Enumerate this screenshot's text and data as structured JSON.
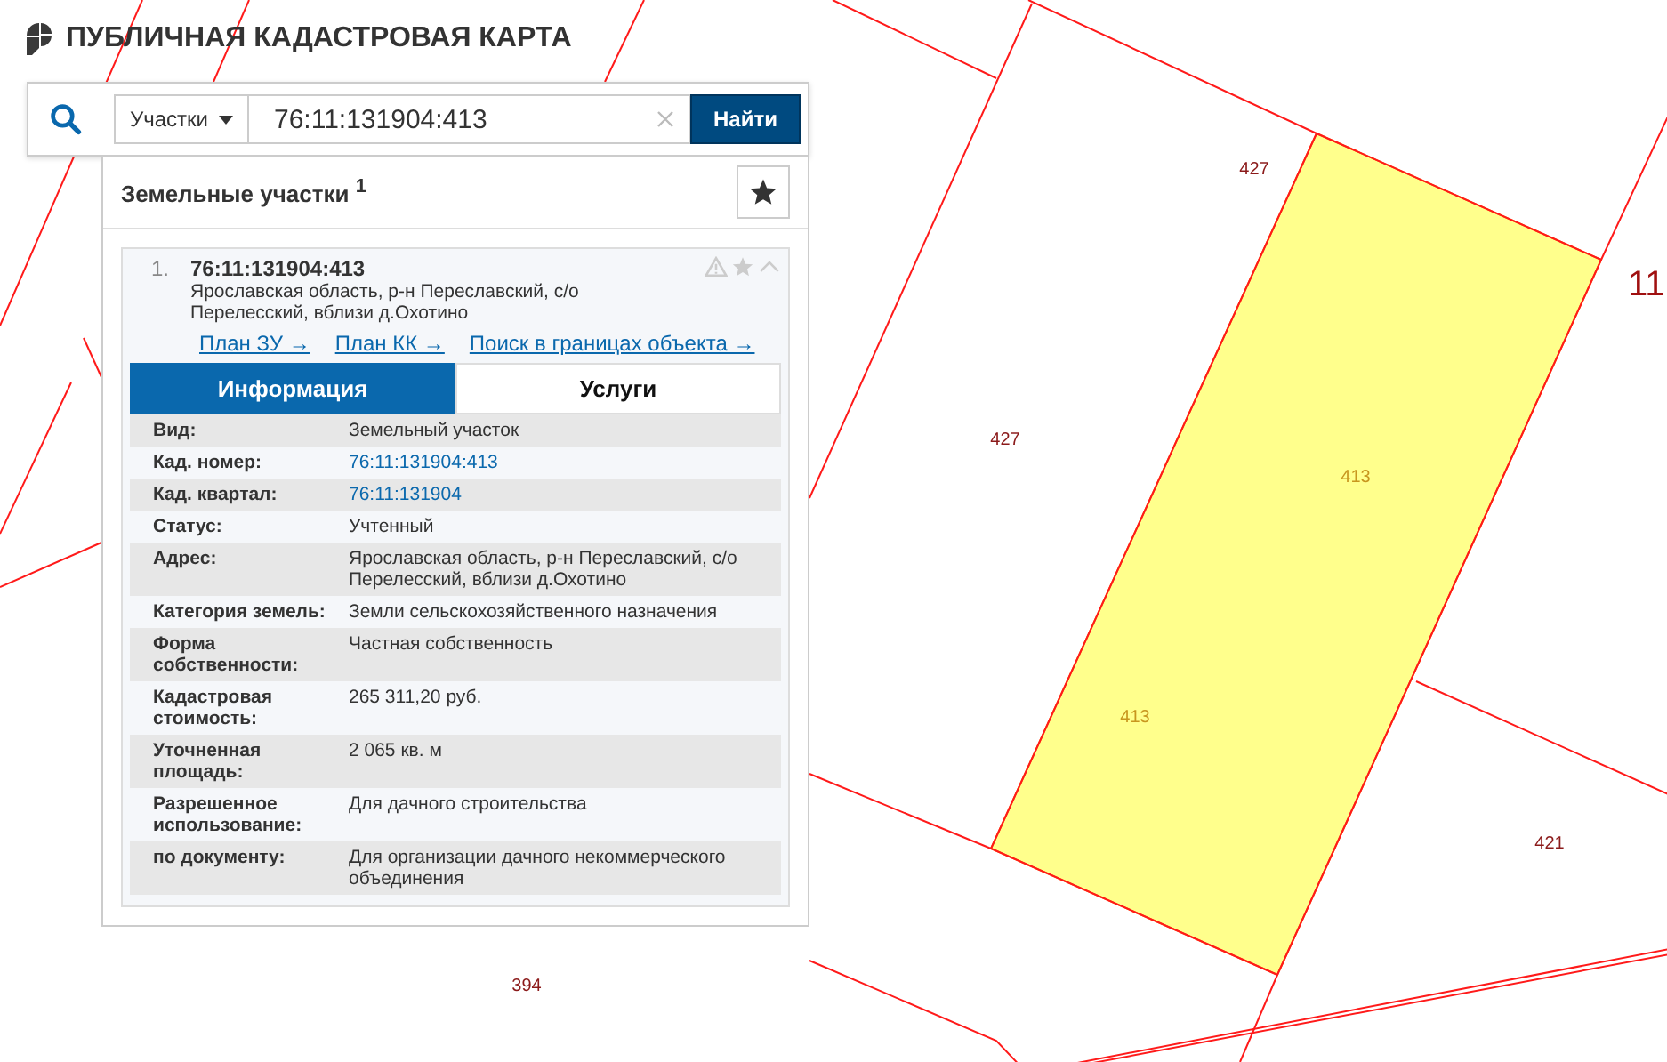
{
  "header": {
    "title": "ПУБЛИЧНАЯ КАДАСТРОВАЯ КАРТА"
  },
  "search": {
    "category": "Участки",
    "value": "76:11:131904:413",
    "button": "Найти"
  },
  "results": {
    "title": "Земельные участки $^{1}$"
  },
  "result": {
    "index": "1.",
    "number": "76:11:131904:413",
    "address": "Ярославская область, р-н Переславский, с/о Перелесский, вблизи д.Охотино",
    "expanded": true,
    "links": [
      "План ЗУ →",
      "План КК →",
      "Поиск в границах объекта →"
    ]
  },
  "tabs": [
    {
      "label": "Информация",
      "selected": true
    },
    {
      "label": "Услуги",
      "selected": false
    }
  ],
  "attributes": [
    {
      "label": "Вид:",
      "value": "Земельный участок",
      "kind": "text"
    },
    {
      "label": "Кад. номер:",
      "value": "76:11:131904:413",
      "kind": "link"
    },
    {
      "label": "Кад. квартал:",
      "value": "76:11:131904",
      "kind": "link"
    },
    {
      "label": "Статус:",
      "value": "Учтенный",
      "kind": "text"
    },
    {
      "label": "Адрес:",
      "value": "Ярославская область, р-н Переславский, с/о Перелесский, вблизи д.Охотино",
      "kind": "text"
    },
    {
      "label": "Категория земель:",
      "value": "Земли сельскохозяйственного назначения",
      "kind": "text"
    },
    {
      "label": "Форма собственности:",
      "value": "Частная собственность",
      "kind": "text"
    },
    {
      "label": "Кадастровая стоимость:",
      "value": "265 311,20 руб.",
      "kind": "text"
    },
    {
      "label": "Уточненная площадь:",
      "value": "2 065 кв. м",
      "kind": "text"
    },
    {
      "label": "Разрешенное использование:",
      "value": "Для дачного строительства",
      "kind": "text"
    },
    {
      "label": "по документу:",
      "value": "Для организации дачного некоммерческого объединения",
      "kind": "text"
    }
  ],
  "map": {
    "labels": [
      {
        "text": "427",
        "kind": "parcel"
      },
      {
        "text": "427",
        "kind": "parcel"
      },
      {
        "text": "413",
        "kind": "selected"
      },
      {
        "text": "413",
        "kind": "selected"
      },
      {
        "text": "421",
        "kind": "parcel"
      },
      {
        "text": "11",
        "kind": "quarter"
      },
      {
        "text": "394",
        "kind": "parcel"
      }
    ]
  }
}
